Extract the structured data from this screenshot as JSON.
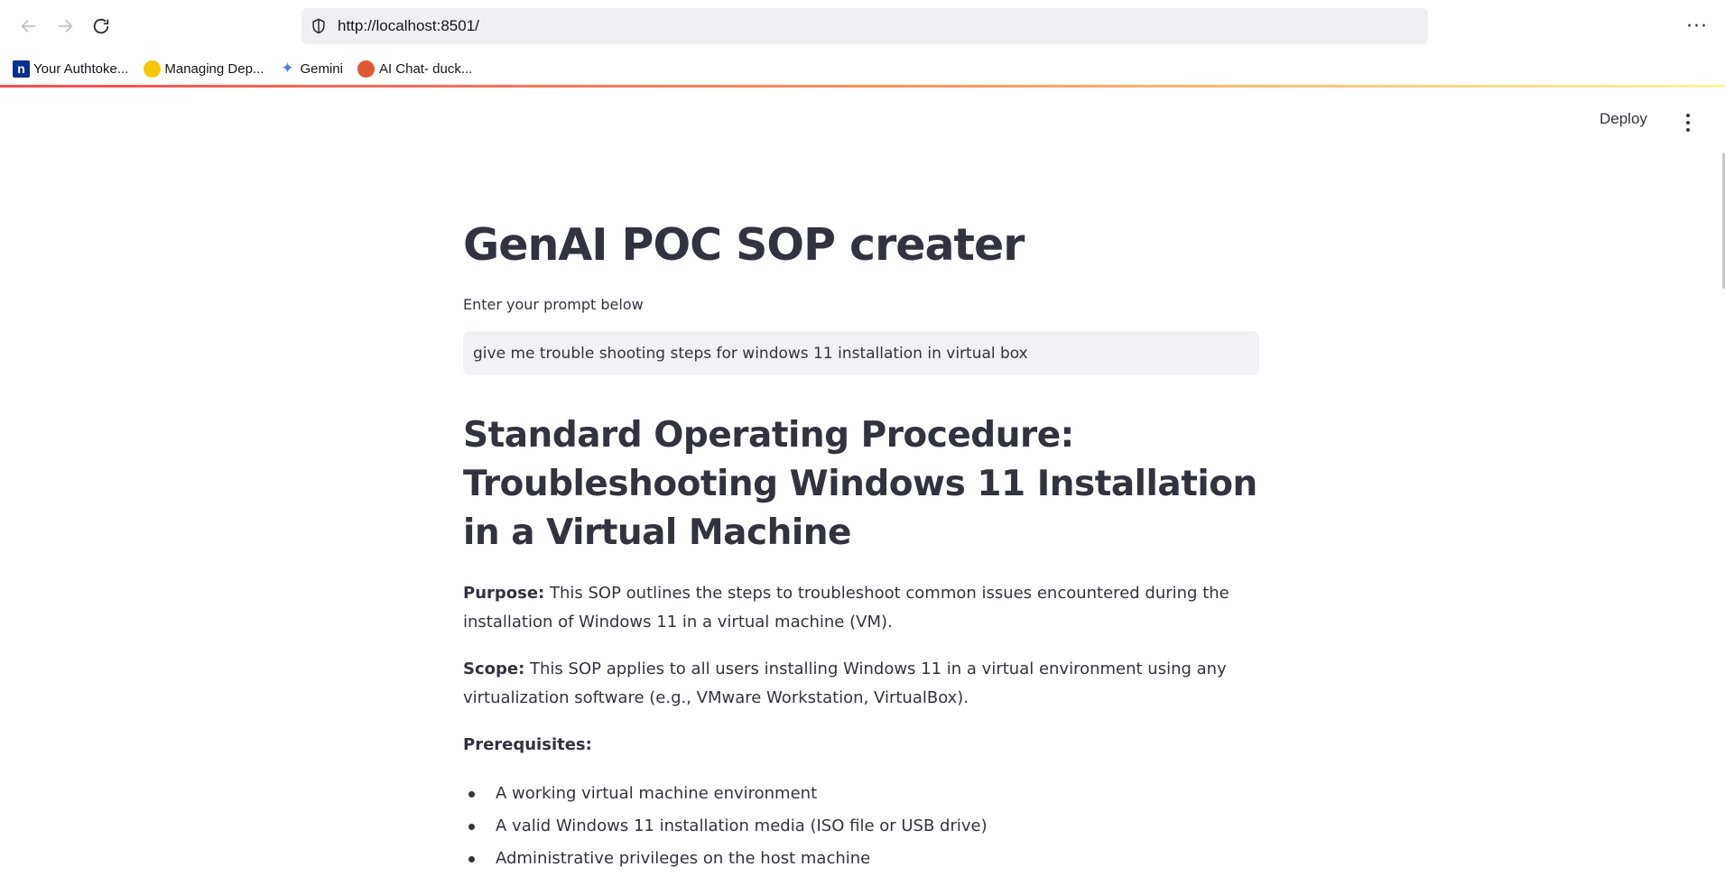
{
  "browser": {
    "url": "http://localhost:8501/",
    "bookmarks": [
      {
        "label": "Your Authtoke...",
        "icon": "notion-icon"
      },
      {
        "label": "Managing Dep...",
        "icon": "managing-icon"
      },
      {
        "label": "Gemini",
        "icon": "gemini-icon"
      },
      {
        "label": "AI Chat- duck...",
        "icon": "duckduckgo-icon"
      }
    ],
    "menu_label": "···"
  },
  "app": {
    "deploy_label": "Deploy",
    "title": "GenAI POC SOP creater",
    "prompt_label": "Enter your prompt below",
    "prompt_value": "give me trouble shooting steps for windows 11 installation in virtual box",
    "accent_colors": [
      "#ff4b4b",
      "#fff3a0"
    ]
  },
  "sop": {
    "heading": "Standard Operating Procedure: Troubleshooting Windows 11 Installation in a Virtual Machine",
    "purpose_label": "Purpose:",
    "purpose_text": " This SOP outlines the steps to troubleshoot common issues encountered during the installation of Windows 11 in a virtual machine (VM).",
    "scope_label": "Scope:",
    "scope_text": " This SOP applies to all users installing Windows 11 in a virtual environment using any virtualization software (e.g., VMware Workstation, VirtualBox).",
    "prerequisites_label": "Prerequisites:",
    "prerequisites": [
      "A working virtual machine environment",
      "A valid Windows 11 installation media (ISO file or USB drive)",
      "Administrative privileges on the host machine"
    ]
  }
}
